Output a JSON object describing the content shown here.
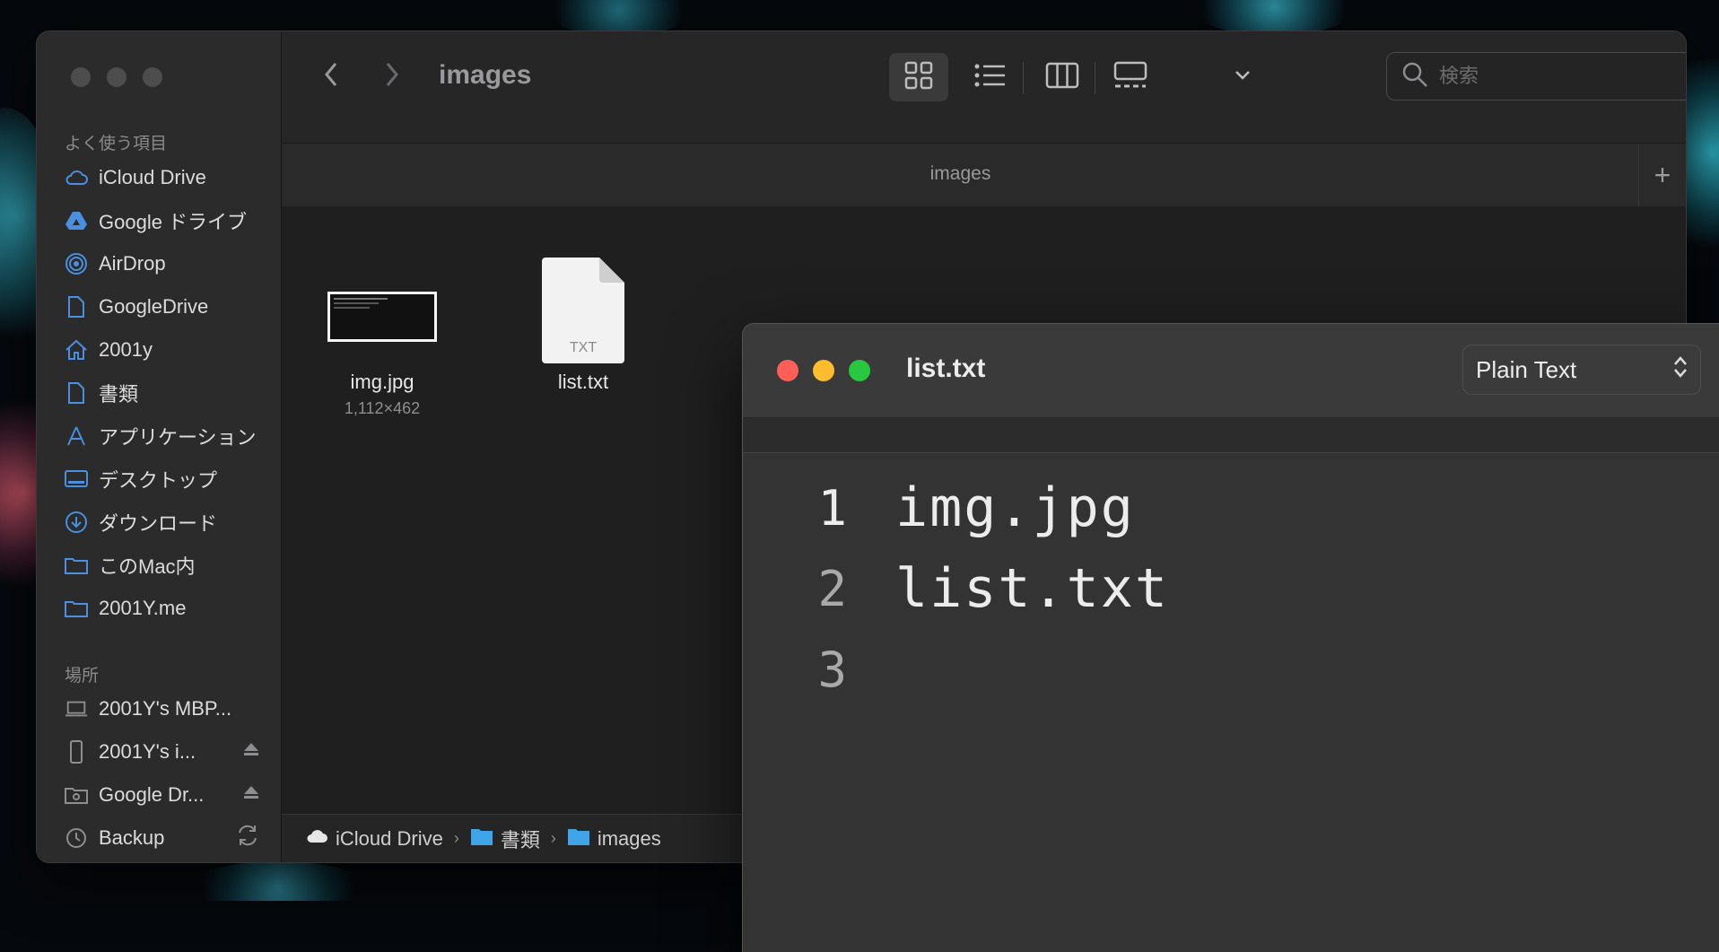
{
  "finder": {
    "title": "images",
    "tab_label": "images",
    "search_placeholder": "検索",
    "sidebar": {
      "favorites_header": "よく使う項目",
      "favorites": [
        {
          "label": "iCloud Drive",
          "icon": "cloud-icon"
        },
        {
          "label": "Google ドライブ",
          "icon": "google-drive-icon"
        },
        {
          "label": "AirDrop",
          "icon": "airdrop-icon"
        },
        {
          "label": "GoogleDrive",
          "icon": "document-icon"
        },
        {
          "label": "2001y",
          "icon": "home-icon"
        },
        {
          "label": "書類",
          "icon": "document-icon"
        },
        {
          "label": "アプリケーション",
          "icon": "applications-icon"
        },
        {
          "label": "デスクトップ",
          "icon": "desktop-icon"
        },
        {
          "label": "ダウンロード",
          "icon": "download-icon"
        },
        {
          "label": "このMac内",
          "icon": "folder-icon"
        },
        {
          "label": "2001Y.me",
          "icon": "folder-icon"
        }
      ],
      "locations_header": "場所",
      "locations": [
        {
          "label": "2001Y's MBP...",
          "icon": "laptop-icon"
        },
        {
          "label": "2001Y's i...",
          "icon": "phone-icon",
          "trail": "eject-icon"
        },
        {
          "label": "Google Dr...",
          "icon": "drive-icon",
          "trail": "eject-icon"
        },
        {
          "label": "Backup",
          "icon": "clock-icon",
          "trail": "sync-icon"
        }
      ]
    },
    "files": [
      {
        "name": "img.jpg",
        "sub": "1,112×462",
        "icon": "image-thumbnail-icon"
      },
      {
        "name": "list.txt",
        "sub": "",
        "icon": "txt-file-icon",
        "badge": "TXT"
      }
    ],
    "pathbar": [
      "iCloud Drive",
      "書類",
      "images"
    ]
  },
  "editor": {
    "title": "list.txt",
    "language": "Plain Text",
    "lines": [
      {
        "n": "1",
        "text": "img.jpg"
      },
      {
        "n": "2",
        "text": "list.txt"
      },
      {
        "n": "3",
        "text": ""
      }
    ]
  },
  "colors": {
    "close": "#ff5f57",
    "minimize": "#febc2e",
    "zoom": "#28c840",
    "accent": "#4a8fe0"
  }
}
